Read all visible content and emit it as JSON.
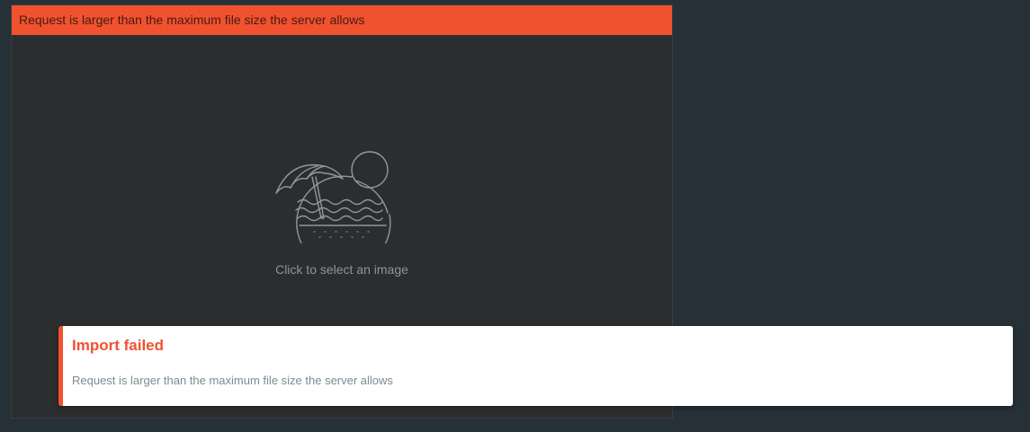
{
  "upload": {
    "error_banner": "Request is larger than the maximum file size the server allows",
    "hint": "Click to select an image",
    "placeholder_icon": "beach-umbrella-sun-icon"
  },
  "toast": {
    "title": "Import failed",
    "message": "Request is larger than the maximum file size the server allows",
    "accent_color": "#f05230"
  },
  "colors": {
    "page_background": "#263037",
    "panel_background": "#2c2d2f",
    "error": "#f05230",
    "muted_text": "#8a959c"
  }
}
